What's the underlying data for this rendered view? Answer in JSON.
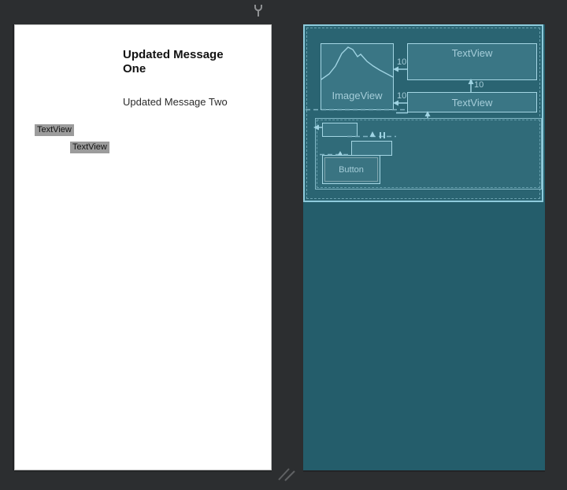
{
  "toolbar": {
    "wrench_icon": "wrench"
  },
  "design": {
    "heading": "Updated Message One",
    "subheading": "Updated Message Two",
    "chip1": "TextView",
    "chip2": "TextView"
  },
  "blueprint": {
    "imageview_label": "ImageView",
    "textview_top_label": "TextView",
    "textview_mid_label": "TextView",
    "button_label": "Button",
    "margin_top": "10",
    "margin_mid": "10",
    "margin_between": "10",
    "colors": {
      "window_bg": "#2c2e30",
      "canvas": "#245d6b",
      "root_bg": "#2a6472",
      "widget_fill": "#3a7685",
      "outline": "#9fd3e2",
      "blueprint_text": "#a5cdd9",
      "chip_bg": "#9c9c9c"
    }
  }
}
